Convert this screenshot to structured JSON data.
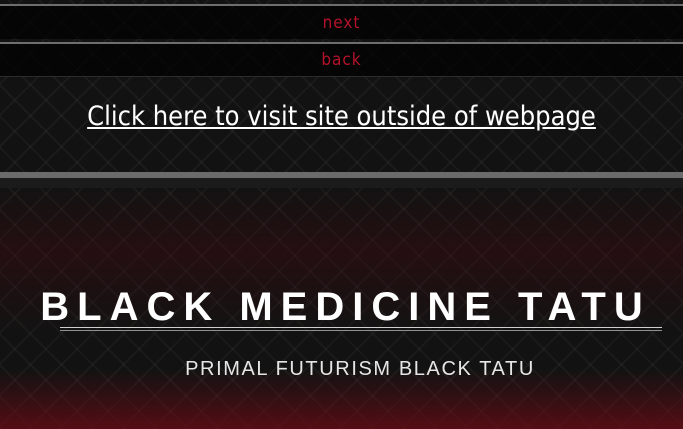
{
  "navigation": {
    "next_label": "next",
    "back_label": "back"
  },
  "external_link": {
    "text": "Click here to visit site outside of webpage"
  },
  "hero": {
    "title": "BLACK MEDICINE TATU",
    "subtitle": "PRIMAL FUTURISM BLACK TATU"
  },
  "colors": {
    "accent": "#b5122a",
    "background": "#121212",
    "text": "#ffffff"
  }
}
